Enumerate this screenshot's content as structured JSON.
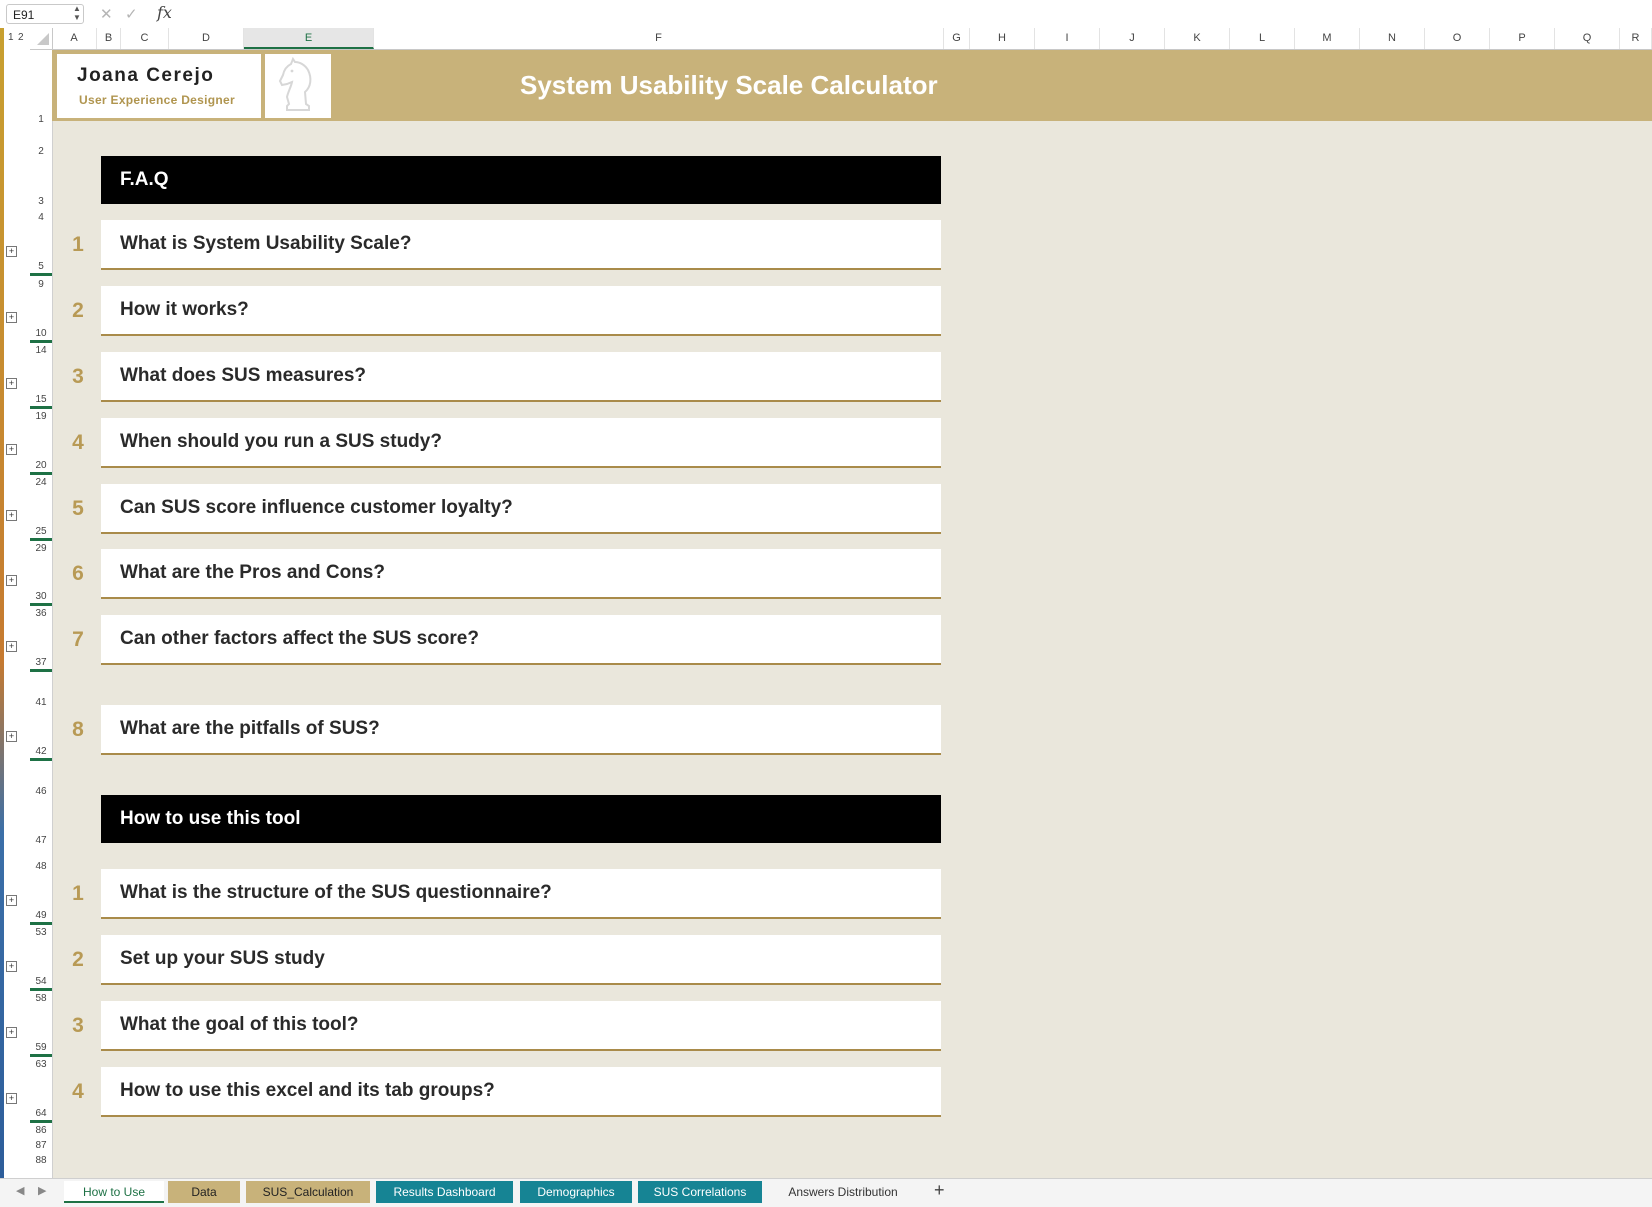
{
  "formula_bar": {
    "cell_ref": "E91",
    "cancel_icon": "x-icon",
    "enter_icon": "check-icon",
    "fx_label": "fx",
    "formula": ""
  },
  "outline_levels": [
    "1",
    "2"
  ],
  "columns": [
    "A",
    "B",
    "C",
    "D",
    "E",
    "F",
    "G",
    "H",
    "I",
    "J",
    "K",
    "L",
    "M",
    "N",
    "O",
    "P",
    "Q",
    "R"
  ],
  "selected_column": "E",
  "rows": [
    "1",
    "2",
    "3",
    "4",
    "5",
    "9",
    "10",
    "14",
    "15",
    "19",
    "20",
    "24",
    "25",
    "29",
    "30",
    "36",
    "37",
    "41",
    "42",
    "46",
    "47",
    "48",
    "49",
    "53",
    "54",
    "58",
    "59",
    "63",
    "64",
    "86",
    "87",
    "88"
  ],
  "header": {
    "name": "Joana Cerejo",
    "role": "User Experience Designer",
    "logo_icon": "chess-knight-icon",
    "title": "System Usability Scale Calculator"
  },
  "faq": {
    "heading": "F.A.Q",
    "items": [
      {
        "num": "1",
        "text": "What is System Usability Scale?"
      },
      {
        "num": "2",
        "text": "How it works?"
      },
      {
        "num": "3",
        "text": "What does SUS measures?"
      },
      {
        "num": "4",
        "text": "When should you run a SUS study?"
      },
      {
        "num": "5",
        "text": "Can SUS score influence customer loyalty?"
      },
      {
        "num": "6",
        "text": "What are the Pros and Cons?"
      },
      {
        "num": "7",
        "text": "Can other factors affect the SUS score?"
      },
      {
        "num": "8",
        "text": "What are the pitfalls of SUS?"
      }
    ]
  },
  "howto": {
    "heading": "How to use this tool",
    "items": [
      {
        "num": "1",
        "text": "What is the structure of the SUS questionnaire?"
      },
      {
        "num": "2",
        "text": "Set up your SUS study"
      },
      {
        "num": "3",
        "text": "What the goal of this tool?"
      },
      {
        "num": "4",
        "text": "How to use this excel and its tab groups?"
      }
    ]
  },
  "tabs": {
    "items": [
      {
        "label": "How to Use",
        "style": "active"
      },
      {
        "label": "Data",
        "style": "gold"
      },
      {
        "label": "SUS_Calculation",
        "style": "gold"
      },
      {
        "label": "Results Dashboard",
        "style": "teal"
      },
      {
        "label": "Demographics",
        "style": "teal"
      },
      {
        "label": "SUS Correlations",
        "style": "teal"
      },
      {
        "label": "Answers Distribution",
        "style": "plain"
      }
    ],
    "add_label": "+"
  },
  "colors": {
    "accent_gold": "#c8b27a",
    "number_gold": "#b89a55",
    "teal_tab": "#168494",
    "excel_green": "#1e7145"
  }
}
